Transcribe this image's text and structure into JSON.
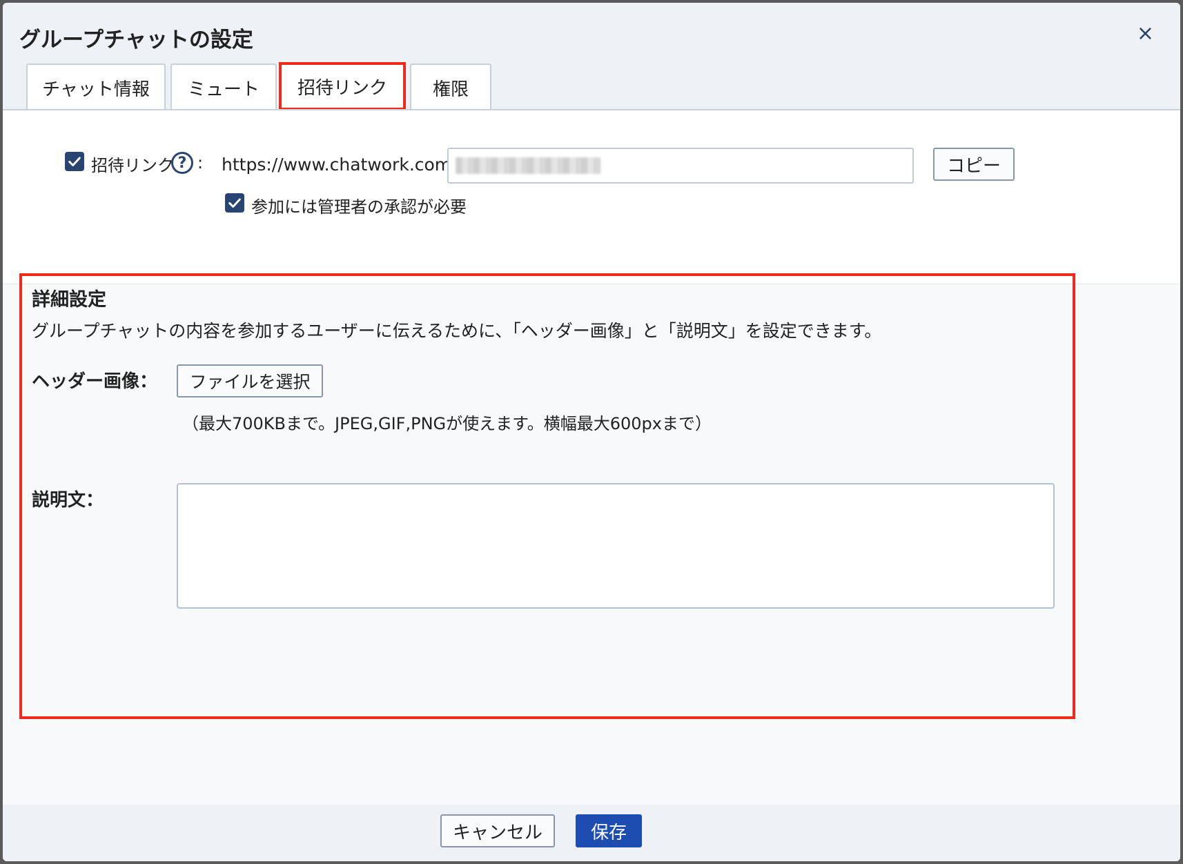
{
  "dialog": {
    "title": "グループチャットの設定",
    "close_label": "×"
  },
  "tabs": [
    {
      "label": "チャット情報"
    },
    {
      "label": "ミュート"
    },
    {
      "label": "招待リンク"
    },
    {
      "label": "権限"
    }
  ],
  "invite": {
    "checkbox_label": "招待リンク",
    "help_label": "?",
    "colon": ":",
    "url_prefix": "https://www.chatwork.com/g/",
    "copy_label": "コピー",
    "approval_label": "参加には管理者の承認が必要"
  },
  "details": {
    "title": "詳細設定",
    "description": "グループチャットの内容を参加するユーザーに伝えるために、「ヘッダー画像」と「説明文」を設定できます。",
    "header_image_label": "ヘッダー画像：",
    "file_button_label": "ファイルを選択",
    "file_note": "（最大700KBまで。JPEG,GIF,PNGが使えます。横幅最大600pxまで）",
    "description_label": "説明文："
  },
  "footer": {
    "cancel_label": "キャンセル",
    "save_label": "保存"
  },
  "colors": {
    "primary": "#1d4db0",
    "checkbox": "#2a4472",
    "highlight": "#ee2a1b"
  }
}
